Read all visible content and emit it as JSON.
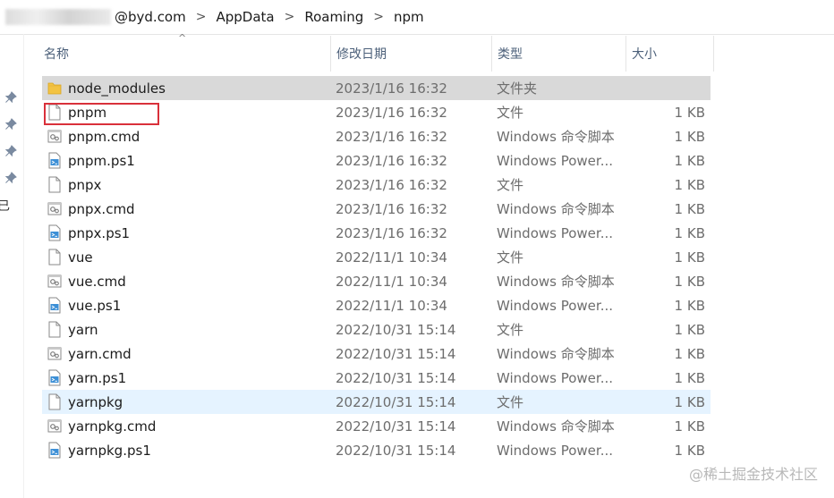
{
  "breadcrumb": {
    "account_suffix": "@byd.com",
    "items": [
      "AppData",
      "Roaming",
      "npm"
    ],
    "separator": ">"
  },
  "columns": {
    "name": "名称",
    "date": "修改日期",
    "type": "类型",
    "size": "大小",
    "sort_indicator": "^"
  },
  "sidebar": {
    "pins": [
      "pin-icon",
      "pin-icon",
      "pin-icon",
      "pin-icon"
    ],
    "glyph": "已"
  },
  "files": [
    {
      "name": "node_modules",
      "date": "2023/1/16 16:32",
      "type": "文件夹",
      "size": "",
      "icon": "folder-icon",
      "state": "selected"
    },
    {
      "name": "pnpm",
      "date": "2023/1/16 16:32",
      "type": "文件",
      "size": "1 KB",
      "icon": "file-icon",
      "state": "boxed"
    },
    {
      "name": "pnpm.cmd",
      "date": "2023/1/16 16:32",
      "type": "Windows 命令脚本",
      "size": "1 KB",
      "icon": "cmd-script-icon",
      "state": ""
    },
    {
      "name": "pnpm.ps1",
      "date": "2023/1/16 16:32",
      "type": "Windows Power...",
      "size": "1 KB",
      "icon": "powershell-script-icon",
      "state": ""
    },
    {
      "name": "pnpx",
      "date": "2023/1/16 16:32",
      "type": "文件",
      "size": "1 KB",
      "icon": "file-icon",
      "state": ""
    },
    {
      "name": "pnpx.cmd",
      "date": "2023/1/16 16:32",
      "type": "Windows 命令脚本",
      "size": "1 KB",
      "icon": "cmd-script-icon",
      "state": ""
    },
    {
      "name": "pnpx.ps1",
      "date": "2023/1/16 16:32",
      "type": "Windows Power...",
      "size": "1 KB",
      "icon": "powershell-script-icon",
      "state": ""
    },
    {
      "name": "vue",
      "date": "2022/11/1 10:34",
      "type": "文件",
      "size": "1 KB",
      "icon": "file-icon",
      "state": ""
    },
    {
      "name": "vue.cmd",
      "date": "2022/11/1 10:34",
      "type": "Windows 命令脚本",
      "size": "1 KB",
      "icon": "cmd-script-icon",
      "state": ""
    },
    {
      "name": "vue.ps1",
      "date": "2022/11/1 10:34",
      "type": "Windows Power...",
      "size": "1 KB",
      "icon": "powershell-script-icon",
      "state": ""
    },
    {
      "name": "yarn",
      "date": "2022/10/31 15:14",
      "type": "文件",
      "size": "1 KB",
      "icon": "file-icon",
      "state": ""
    },
    {
      "name": "yarn.cmd",
      "date": "2022/10/31 15:14",
      "type": "Windows 命令脚本",
      "size": "1 KB",
      "icon": "cmd-script-icon",
      "state": ""
    },
    {
      "name": "yarn.ps1",
      "date": "2022/10/31 15:14",
      "type": "Windows Power...",
      "size": "1 KB",
      "icon": "powershell-script-icon",
      "state": ""
    },
    {
      "name": "yarnpkg",
      "date": "2022/10/31 15:14",
      "type": "文件",
      "size": "1 KB",
      "icon": "file-icon",
      "state": "hover"
    },
    {
      "name": "yarnpkg.cmd",
      "date": "2022/10/31 15:14",
      "type": "Windows 命令脚本",
      "size": "1 KB",
      "icon": "cmd-script-icon",
      "state": ""
    },
    {
      "name": "yarnpkg.ps1",
      "date": "2022/10/31 15:14",
      "type": "Windows Power...",
      "size": "1 KB",
      "icon": "powershell-script-icon",
      "state": ""
    }
  ],
  "watermark": "@稀土掘金技术社区",
  "colors": {
    "selected_row": "#d9d9d9",
    "hover_row": "#e5f3ff",
    "annotation_box": "#d9303a",
    "folder": "#f3c343"
  }
}
